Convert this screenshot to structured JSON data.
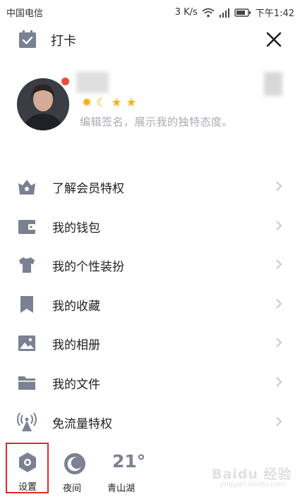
{
  "status_bar": {
    "carrier": "中国电信",
    "network_speed": "3 K/s",
    "time": "下午1:42"
  },
  "header": {
    "checkin_label": "打卡"
  },
  "profile": {
    "signature_placeholder": "编辑签名，展示我的独特态度。",
    "level_badges": [
      "sun-badge",
      "moon-badge",
      "star-badge",
      "star-badge"
    ]
  },
  "menu": {
    "items": [
      {
        "label": "了解会员特权",
        "icon": "crown-icon"
      },
      {
        "label": "我的钱包",
        "icon": "wallet-icon"
      },
      {
        "label": "我的个性装扮",
        "icon": "tshirt-icon"
      },
      {
        "label": "我的收藏",
        "icon": "bookmark-icon"
      },
      {
        "label": "我的相册",
        "icon": "photo-album-icon"
      },
      {
        "label": "我的文件",
        "icon": "folder-icon"
      },
      {
        "label": "免流量特权",
        "icon": "signal-tower-icon"
      }
    ]
  },
  "bottom_bar": {
    "settings_label": "设置",
    "night_label": "夜间",
    "temperature": "21°",
    "city": "青山湖"
  },
  "watermark": {
    "text": "Baidu 经验",
    "url": "jingyan.baidu.com"
  },
  "colors": {
    "icon_gray": "#7b8092",
    "highlight_border": "#e02b2b",
    "online_dot": "#f04a3e",
    "badge_gold": "#f6b21b",
    "signature_gray": "#a8abb4"
  }
}
